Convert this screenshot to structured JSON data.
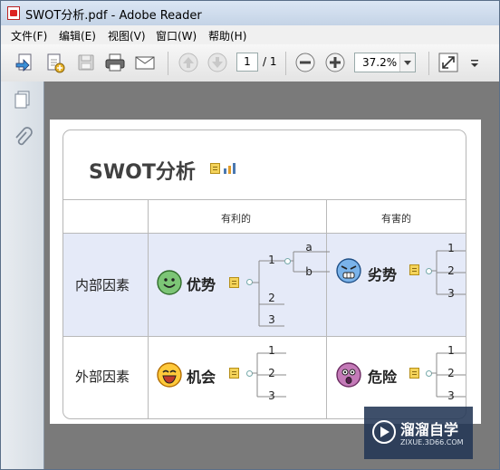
{
  "window": {
    "title": "SWOT分析.pdf - Adobe Reader"
  },
  "menu": [
    {
      "label": "文件(F)"
    },
    {
      "label": "编辑(E)"
    },
    {
      "label": "视图(V)"
    },
    {
      "label": "窗口(W)"
    },
    {
      "label": "帮助(H)"
    }
  ],
  "toolbar": {
    "page_current": "1",
    "page_total": "/ 1",
    "zoom": "37.2%"
  },
  "document": {
    "title": "SWOT分析",
    "col_headers": [
      "有利的",
      "有害的"
    ],
    "rows": [
      {
        "label": "内部因素",
        "favorable": {
          "name": "优势",
          "face": "smile-face-icon",
          "branches": [
            "1",
            "2",
            "3"
          ],
          "sub_branches": [
            "a",
            "b"
          ]
        },
        "harmful": {
          "name": "劣势",
          "face": "angry-face-icon",
          "branches": [
            "1",
            "2",
            "3"
          ]
        }
      },
      {
        "label": "外部因素",
        "favorable": {
          "name": "机会",
          "face": "laugh-face-icon",
          "branches": [
            "1",
            "2",
            "3"
          ]
        },
        "harmful": {
          "name": "危险",
          "face": "scared-face-icon",
          "branches": [
            "1",
            "2",
            "3"
          ]
        }
      }
    ]
  },
  "colors": {
    "row_highlight": "#e5eaf8",
    "accent": "#4a78b0"
  },
  "watermark": {
    "text": "溜溜自学",
    "url": "ZIXUE.3D66.COM"
  }
}
